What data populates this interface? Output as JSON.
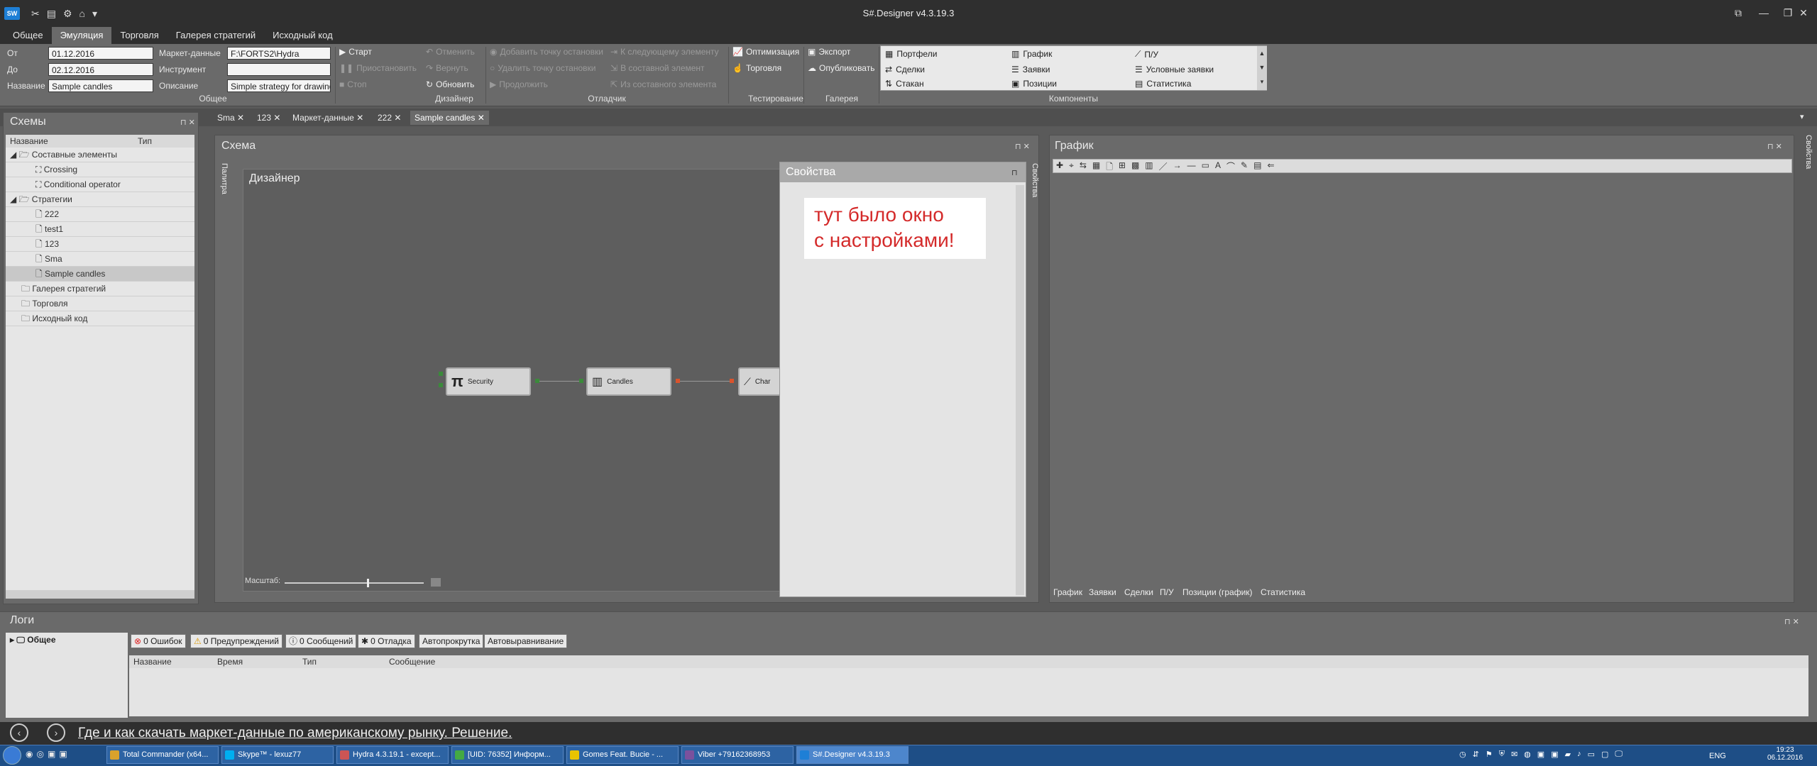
{
  "window": {
    "title": "S#.Designer v4.3.19.3",
    "logo": "SW",
    "minimize_icon": "minimize-icon",
    "maximize_icon": "maximize-icon",
    "close_icon": "close-icon"
  },
  "menu_tabs": [
    "Общее",
    "Эмуляция",
    "Торговля",
    "Галерея стратегий",
    "Исходный код"
  ],
  "ribbon": {
    "common": {
      "from_label": "От",
      "from_value": "01.12.2016",
      "to_label": "До",
      "to_value": "02.12.2016",
      "name_label": "Название",
      "name_value": "Sample candles",
      "market_data_label": "Маркет-данные",
      "market_data_value": "F:\\FORTS2\\Hydra",
      "instrument_label": "Инструмент",
      "instrument_value": "",
      "description_label": "Описание",
      "description_value": "Simple strategy for drawing",
      "caption": "Общее"
    },
    "designer": {
      "start": "Старт",
      "pause": "Приостановить",
      "stop": "Стоп",
      "caption": "Дизайнер"
    },
    "edit": {
      "undo": "Отменить",
      "redo": "Вернуть",
      "refresh": "Обновить"
    },
    "debugger": {
      "add_breakpoint": "Добавить точку остановки",
      "remove_breakpoint": "Удалить точку остановки",
      "continue": "Продолжить",
      "next_element": "К следующему элементу",
      "composite_element": "В составной элемент",
      "out_composite": "Из составного элемента",
      "caption": "Отладчик"
    },
    "testing": {
      "optimization": "Оптимизация",
      "trading": "Торговля",
      "caption": "Тестирование"
    },
    "gallery": {
      "export": "Экспорт",
      "publish": "Опубликовать",
      "caption": "Галерея"
    },
    "components": {
      "items": [
        "Портфели",
        "График",
        "П/У",
        "Сделки",
        "Заявки",
        "Условные заявки",
        "Стакан",
        "Позиции",
        "Статистика"
      ],
      "caption": "Компоненты"
    }
  },
  "doc_tabs": [
    "Sma",
    "123",
    "Маркет-данные",
    "222",
    "Sample candles"
  ],
  "schemes_panel": {
    "title": "Схемы",
    "col_name": "Название",
    "col_type": "Тип",
    "tree": [
      {
        "label": "Составные элементы"
      },
      {
        "label": "Crossing"
      },
      {
        "label": "Conditional operator"
      },
      {
        "label": "Стратегии"
      },
      {
        "label": "222"
      },
      {
        "label": "test1"
      },
      {
        "label": "123"
      },
      {
        "label": "Sma"
      },
      {
        "label": "Sample candles"
      },
      {
        "label": "Галерея стратегий"
      },
      {
        "label": "Торговля"
      },
      {
        "label": "Исходный код"
      }
    ]
  },
  "schema_panel": {
    "title": "Схема",
    "palette_tab": "Палитра",
    "designer_title": "Дизайнер",
    "scale_label": "Масштаб:",
    "scale_value": 0.6,
    "nodes": [
      "Security",
      "Candles",
      "Char"
    ]
  },
  "properties_panel": {
    "title": "Свойства",
    "side_tab": "Свойства",
    "note_line1": "тут было окно",
    "note_line2": "с настройками!"
  },
  "chart_panel": {
    "title": "График",
    "side_tab": "Свойства",
    "bottom_tabs": [
      "График",
      "Заявки",
      "Сделки",
      "П/У",
      "Позиции (график)",
      "Статистика"
    ]
  },
  "logs_panel": {
    "title": "Логи",
    "tree_item": "Общее",
    "errors": "0 Ошибок",
    "warnings": "0 Предупреждений",
    "messages": "0 Сообщений",
    "debug": "0 Отладка",
    "autoscroll": "Автопрокрутка",
    "autoalign": "Автовыравнивание",
    "columns": [
      "Название",
      "Время",
      "Тип",
      "Сообщение"
    ]
  },
  "news": {
    "text": "Где и как скачать маркет-данные по американскому рынку. Решение."
  },
  "taskbar": {
    "items": [
      "Total Commander (x64...",
      "Skype™ - lexuz77",
      "Hydra 4.3.19.1 - except...",
      "[UID: 76352] Информ...",
      "Gomes Feat. Bucie - ...",
      "Viber +79162368953",
      "S#.Designer v4.3.19.3"
    ],
    "lang": "ENG",
    "time": "19:23",
    "date": "06.12.2016"
  },
  "colors": {
    "accent": "#1e7fd6",
    "note_text": "#d42a2a",
    "taskbar": "#1e4e86"
  }
}
